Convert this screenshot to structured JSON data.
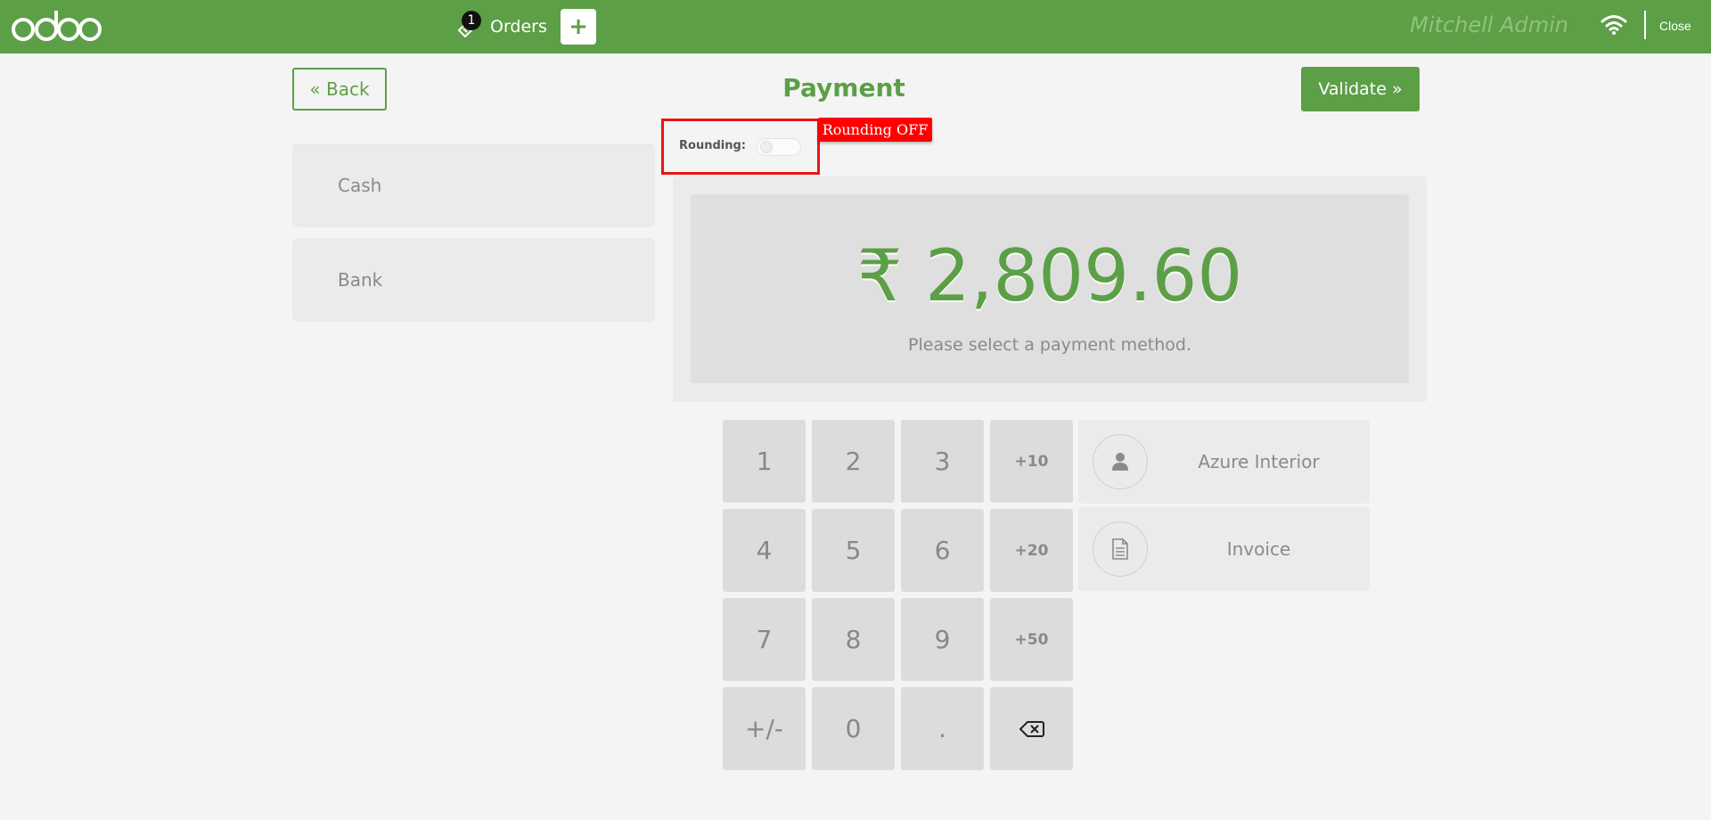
{
  "topbar": {
    "logo_text": "odoo",
    "orders_label": "Orders",
    "orders_count": "1",
    "new_order_icon": "plus-icon",
    "user_name": "Mitchell Admin",
    "wifi_icon": "wifi-icon",
    "close_label": "Close"
  },
  "header": {
    "back_label": "« Back",
    "title": "Payment",
    "validate_label": "Validate »"
  },
  "rounding": {
    "label": "Rounding:",
    "enabled": false,
    "tag": "Rounding OFF"
  },
  "payment_methods": [
    {
      "label": "Cash"
    },
    {
      "label": "Bank"
    }
  ],
  "summary": {
    "amount": "₹ 2,809.60",
    "hint": "Please select a payment method."
  },
  "numpad": {
    "keys": [
      "1",
      "2",
      "3",
      "+10",
      "4",
      "5",
      "6",
      "+20",
      "7",
      "8",
      "9",
      "+50",
      "+/-",
      "0",
      ".",
      "backspace"
    ]
  },
  "actions": {
    "customer_label": "Azure Interior",
    "customer_icon": "user-icon",
    "invoice_label": "Invoice",
    "invoice_icon": "document-icon"
  },
  "colors": {
    "brand": "#5c9f47",
    "highlight": "#ff0000"
  }
}
